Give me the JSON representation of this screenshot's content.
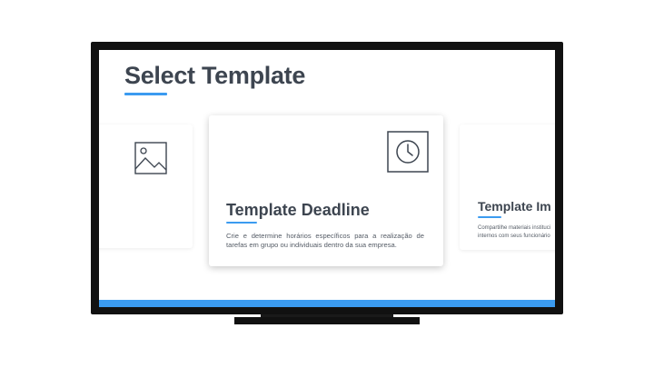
{
  "screen": {
    "title": "Select Template"
  },
  "cards": {
    "left": {
      "icon": "image-icon"
    },
    "center": {
      "icon": "clock-icon",
      "title": "Template Deadline",
      "description": "Crie e determine horários específicos para a realização de tarefas em grupo ou individuais dentro da sua empresa."
    },
    "right": {
      "title": "Template Im",
      "description_line1": "Compartilhe materiais instituci",
      "description_line2": "internos com seus funcionário"
    }
  },
  "colors": {
    "accent": "#3b9bf0",
    "title_text": "#3d4550",
    "bezel": "#111111"
  }
}
